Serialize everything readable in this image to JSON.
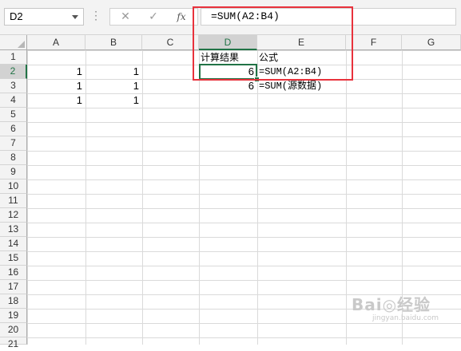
{
  "formula_bar": {
    "name_box": "D2",
    "cancel_icon": "✕",
    "enter_icon": "✓",
    "fx_label": "fx",
    "formula": "=SUM(A2:B4)"
  },
  "columns": [
    "A",
    "B",
    "C",
    "D",
    "E",
    "F",
    "G"
  ],
  "rows": [
    "1",
    "2",
    "3",
    "4",
    "5",
    "6",
    "7",
    "8",
    "9",
    "10",
    "11",
    "12",
    "13",
    "14",
    "15",
    "16",
    "17",
    "18",
    "19",
    "20",
    "21"
  ],
  "selected_column": "D",
  "selected_row": "2",
  "cells": {
    "A2": "1",
    "B2": "1",
    "A3": "1",
    "B3": "1",
    "A4": "1",
    "B4": "1",
    "D1": "计算结果",
    "E1": "公式",
    "D2": "6",
    "E2": "=SUM(A2:B4)",
    "D3": "6",
    "E3": "=SUM(源数据)"
  },
  "watermark": {
    "brand": "Bai◎经验",
    "url": "jingyan.baidu.com"
  },
  "colors": {
    "selection_green": "#217346",
    "annotation_red": "#e8323c"
  }
}
